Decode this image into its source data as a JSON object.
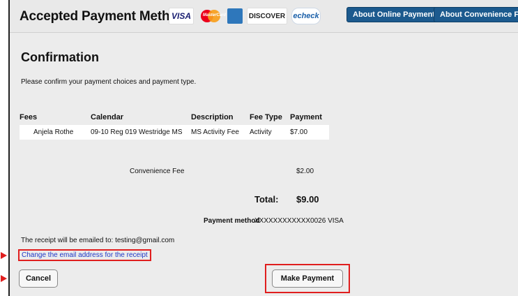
{
  "header": {
    "title": "Accepted Payment Methods",
    "cards": {
      "visa": "VISA",
      "mastercard": "MasterCard",
      "amex": "AMERICAN EXPRESS",
      "discover": "DISCOVER",
      "echeck": "echeck"
    },
    "about_online": "About Online Payments",
    "about_convenience": "About Convenience Fees"
  },
  "main": {
    "title": "Confirmation",
    "instruction": "Please confirm your payment choices and payment type.",
    "table": {
      "columns": [
        "Fees",
        "Calendar",
        "Description",
        "Fee Type",
        "Payment"
      ],
      "rows": [
        [
          "Anjela Rothe",
          "09-10 Reg 019 Westridge MS",
          "MS Activity Fee",
          "Activity",
          "$7.00"
        ]
      ]
    },
    "convenience_label": "Convenience Fee",
    "convenience_amount": "$2.00",
    "total_label": "Total:",
    "total_amount": "$9.00",
    "payment_method_label": "Payment method",
    "payment_method_value": "XXXXXXXXXXXX0026 VISA",
    "receipt_text": "The receipt will be emailed to: testing@gmail.com",
    "change_email_link": "Change the email address for the receipt",
    "cancel_label": "Cancel",
    "make_payment_label": "Make Payment"
  },
  "colors": {
    "highlight": "#e01e1e",
    "link": "#1f38c7",
    "header_button": "#1c5a8e"
  }
}
